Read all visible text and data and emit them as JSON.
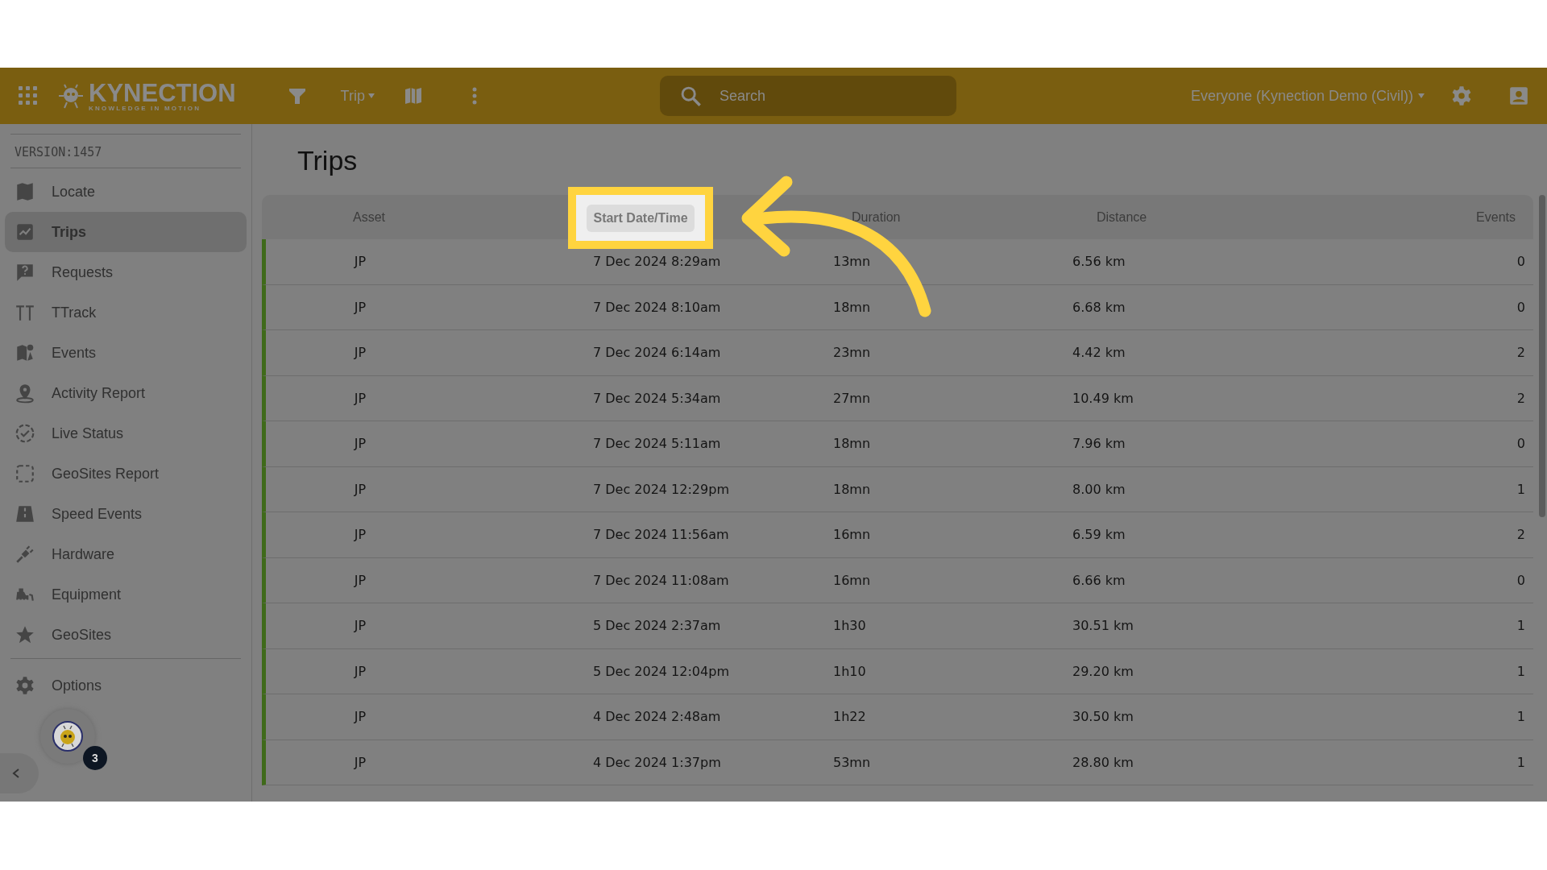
{
  "topbar": {
    "logo": "KYNECTION",
    "tagline": "KNOWLEDGE IN MOTION",
    "menu": "Trip",
    "search": {
      "placeholder": "Search"
    },
    "account": "Everyone (Kynection Demo (Civil))"
  },
  "sidebar": {
    "version": "VERSION:1457",
    "items": [
      {
        "label": "Locate",
        "selected": false
      },
      {
        "label": "Trips",
        "selected": true
      },
      {
        "label": "Requests",
        "selected": false
      },
      {
        "label": "TTrack",
        "selected": false
      },
      {
        "label": "Events",
        "selected": false
      },
      {
        "label": "Activity Report",
        "selected": false
      },
      {
        "label": "Live Status",
        "selected": false
      },
      {
        "label": "GeoSites Report",
        "selected": false
      },
      {
        "label": "Speed Events",
        "selected": false
      },
      {
        "label": "Hardware",
        "selected": false
      },
      {
        "label": "Equipment",
        "selected": false
      },
      {
        "label": "GeoSites",
        "selected": false
      }
    ],
    "footer": {
      "label": "Options",
      "selected": false
    },
    "notification_count": "3"
  },
  "page_title": "Trips",
  "table": {
    "columns": [
      {
        "label": "Asset",
        "highlighted": false
      },
      {
        "label": "Start Date/Time",
        "highlighted": true
      },
      {
        "label": "Duration",
        "highlighted": false
      },
      {
        "label": "Distance",
        "highlighted": false
      },
      {
        "label": "Events",
        "highlighted": false
      }
    ],
    "rows": [
      [
        "JP",
        "7 Dec 2024 8:29am",
        "13mn",
        "6.56 km",
        "0"
      ],
      [
        "JP",
        "7 Dec 2024 8:10am",
        "18mn",
        "6.68 km",
        "0"
      ],
      [
        "JP",
        "7 Dec 2024 6:14am",
        "23mn",
        "4.42 km",
        "2"
      ],
      [
        "JP",
        "7 Dec 2024 5:34am",
        "27mn",
        "10.49 km",
        "2"
      ],
      [
        "JP",
        "7 Dec 2024 5:11am",
        "18mn",
        "7.96 km",
        "0"
      ],
      [
        "JP",
        "7 Dec 2024 12:29pm",
        "18mn",
        "8.00 km",
        "1"
      ],
      [
        "JP",
        "7 Dec 2024 11:56am",
        "16mn",
        "6.59 km",
        "2"
      ],
      [
        "JP",
        "7 Dec 2024 11:08am",
        "16mn",
        "6.66 km",
        "0"
      ],
      [
        "JP",
        "5 Dec 2024 2:37am",
        "1h30",
        "30.51 km",
        "1"
      ],
      [
        "JP",
        "5 Dec 2024 12:04pm",
        "1h10",
        "29.20 km",
        "1"
      ],
      [
        "JP",
        "4 Dec 2024 2:48am",
        "1h22",
        "30.50 km",
        "1"
      ],
      [
        "JP",
        "4 Dec 2024 1:37pm",
        "53mn",
        "28.80 km",
        "1"
      ]
    ]
  }
}
